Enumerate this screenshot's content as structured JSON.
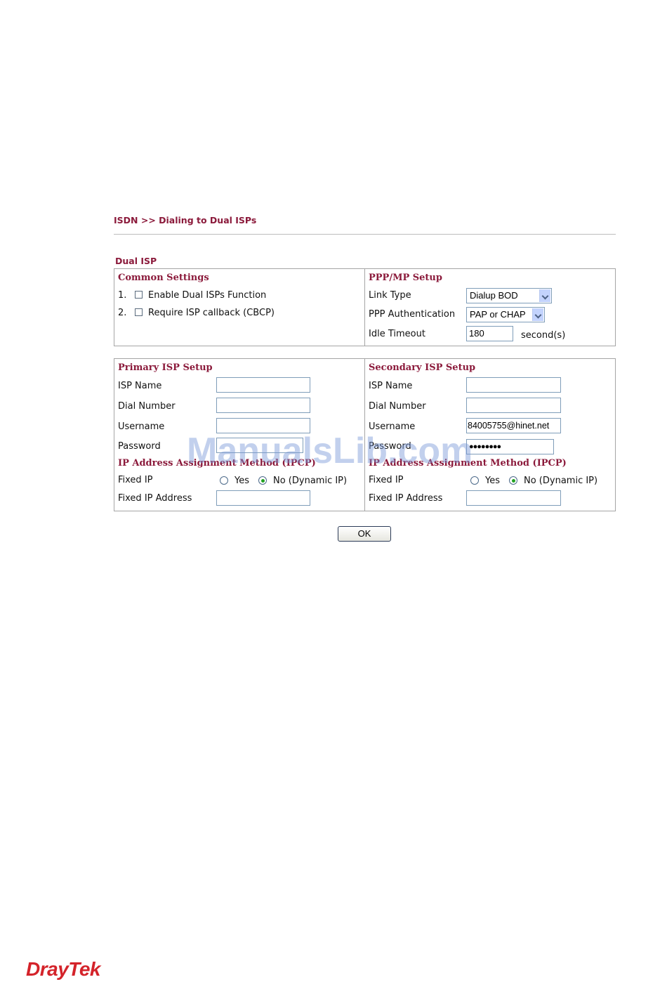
{
  "breadcrumb": "ISDN >> Dialing to Dual ISPs",
  "section_title": "Dual ISP",
  "common": {
    "header": "Common Settings",
    "items": [
      {
        "num": "1.",
        "label": "Enable Dual ISPs Function",
        "checked": false
      },
      {
        "num": "2.",
        "label": "Require ISP callback (CBCP)",
        "checked": false
      }
    ]
  },
  "ppp": {
    "header": "PPP/MP Setup",
    "link_type_label": "Link Type",
    "link_type_value": "Dialup BOD",
    "auth_label": "PPP Authentication",
    "auth_value": "PAP or CHAP",
    "idle_label": "Idle Timeout",
    "idle_value": "180",
    "idle_unit": "second(s)"
  },
  "primary": {
    "header": "Primary ISP Setup",
    "isp_name_label": "ISP Name",
    "isp_name_value": "",
    "dial_label": "Dial Number",
    "dial_value": "",
    "user_label": "Username",
    "user_value": "",
    "pass_label": "Password",
    "pass_value": "",
    "ip_header": "IP Address Assignment Method (IPCP)",
    "fixed_ip_label": "Fixed IP",
    "yes_label": "Yes",
    "no_label": "No (Dynamic IP)",
    "fixed_ip_selected": "No",
    "fixed_addr_label": "Fixed IP Address",
    "fixed_addr_value": ""
  },
  "secondary": {
    "header": "Secondary ISP Setup",
    "isp_name_label": "ISP Name",
    "isp_name_value": "",
    "dial_label": "Dial Number",
    "dial_value": "",
    "user_label": "Username",
    "user_value": "84005755@hinet.net",
    "pass_label": "Password",
    "pass_value": "●●●●●●●●",
    "ip_header": "IP Address Assignment Method (IPCP)",
    "fixed_ip_label": "Fixed IP",
    "yes_label": "Yes",
    "no_label": "No (Dynamic IP)",
    "fixed_ip_selected": "No",
    "fixed_addr_label": "Fixed IP Address",
    "fixed_addr_value": ""
  },
  "ok_label": "OK",
  "watermark": "ManualsLib.com",
  "logo": "DrayTek",
  "colors": {
    "accent": "#8b1a3b",
    "border": "#a5a5a5",
    "logo": "#d4232a"
  }
}
